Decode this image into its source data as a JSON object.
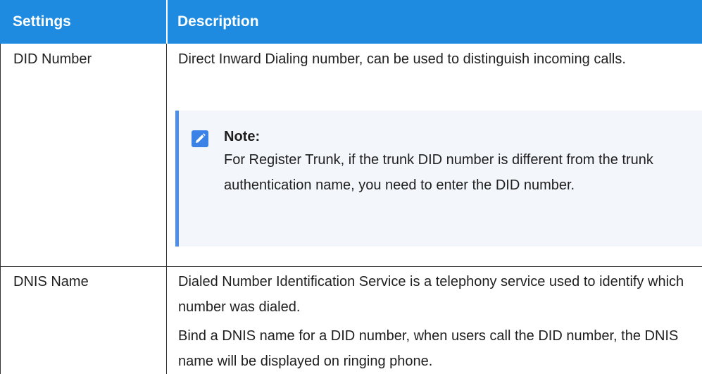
{
  "table": {
    "headers": [
      "Settings",
      "Description"
    ],
    "rows": [
      {
        "setting": "DID Number",
        "description": "Direct Inward Dialing number, can be used to distinguish incoming calls.",
        "note": {
          "title": "Note:",
          "text": "For Register Trunk, if the trunk DID number is different from the trunk authentication name, you need to enter the DID number."
        }
      },
      {
        "setting": "DNIS Name",
        "description_1": "Dialed Number Identification Service is a telephony service used to identify which number was dialed.",
        "description_2": "Bind a DNIS name for a DID number, when users call the DID number, the DNIS name will be displayed on ringing phone."
      }
    ]
  },
  "colors": {
    "header_bg": "#1e8be0",
    "header_text": "#ffffff",
    "note_bg": "#f3f6fa",
    "note_accent": "#4d8fe8",
    "note_icon": "#3b82e6",
    "border": "#333333"
  },
  "icons": {
    "note_icon": "pencil-edit-icon"
  }
}
